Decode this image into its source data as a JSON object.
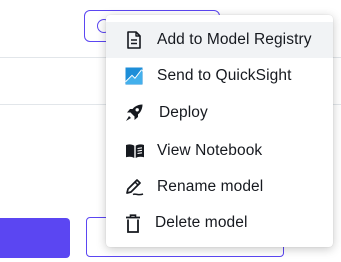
{
  "menu": {
    "items": [
      {
        "label": "Add to Model Registry",
        "icon": "document-icon",
        "highlighted": true
      },
      {
        "label": "Send to QuickSight",
        "icon": "quicksight-icon",
        "highlighted": false
      },
      {
        "label": "Deploy",
        "icon": "rocket-icon",
        "highlighted": false
      },
      {
        "label": "View Notebook",
        "icon": "book-icon",
        "highlighted": false
      },
      {
        "label": "Rename model",
        "icon": "pencil-icon",
        "highlighted": false
      },
      {
        "label": "Delete model",
        "icon": "trash-icon",
        "highlighted": false
      }
    ]
  },
  "colors": {
    "accent": "#5b46f2",
    "quicksight": "#1d8ed8",
    "text": "#16191f",
    "highlight": "#f1f3f5"
  }
}
